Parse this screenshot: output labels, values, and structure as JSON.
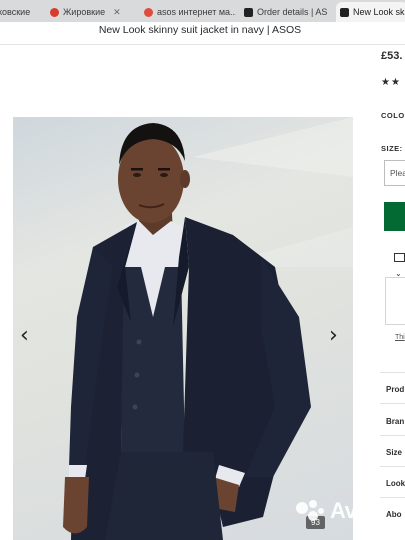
{
  "browser": {
    "tabs": [
      {
        "label": "ковские",
        "active": false
      },
      {
        "label": "Жировкие",
        "active": false
      },
      {
        "label": "asos интернет ма...",
        "active": false
      },
      {
        "label": "Order details | AS",
        "active": false
      },
      {
        "label": "New Look sk",
        "active": true
      }
    ]
  },
  "page": {
    "title": "New Look skinny suit jacket in navy | ASOS"
  },
  "product": {
    "price": "£53.",
    "stars": "★★",
    "colour_label": "COLO",
    "size_label": "SIZE:",
    "size_placeholder": "Plea",
    "this_link": "Thi",
    "accordion": [
      "Prod",
      "Bran",
      "Size",
      "Look",
      "Abo"
    ]
  },
  "gallery": {
    "prev_icon": "chevron-left-icon",
    "next_icon": "chevron-right-icon",
    "counter": "93"
  },
  "watermark": {
    "text": "Avito"
  },
  "colors": {
    "add_button": "#026a32",
    "suit": "#1c2234",
    "shirt": "#e8e8ef",
    "skin": "#6b4331"
  }
}
